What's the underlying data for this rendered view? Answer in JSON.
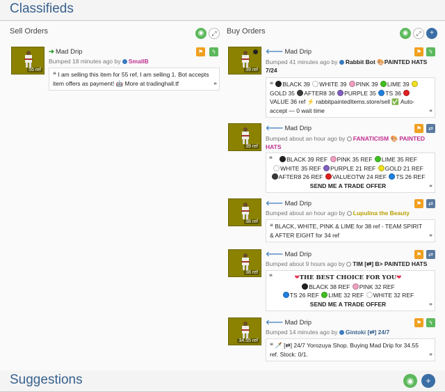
{
  "page": {
    "title": "Classifieds",
    "suggestions_title": "Suggestions"
  },
  "sell": {
    "title": "Sell Orders",
    "listings": [
      {
        "item": "Mad Drip",
        "price": "55 ref",
        "bumped": "Bumped 18 minutes ago by",
        "user": "SmallB",
        "desc": "I am selling this item for 55 ref, I am selling 1. Bot accepts item offers as payment! 🤖 More at tradinghall.tf"
      }
    ]
  },
  "buy": {
    "title": "Buy Orders",
    "listings": [
      {
        "item": "Mad Drip",
        "price": "39 ref",
        "bumped": "Bumped 41 minutes ago by",
        "user": "Rabbit Bot",
        "user_suffix": "🎨PAINTED HATS 7/24",
        "desc_parts": [
          "BLACK 39",
          "WHITE 39",
          "PINK 39",
          "LIME 39",
          "GOLD 35",
          "AFTER8 36",
          "PURPLE 35",
          "TS 36",
          "VALUE 36 ref",
          "⚡ rabbitpaintedItems.store/sell",
          "✅ Auto-accept — 0 wait time"
        ]
      },
      {
        "item": "Mad Drip",
        "price": "39 ref",
        "bumped": "Bumped about an hour ago by",
        "user": "FANATICISM",
        "user_suffix": "🎨 PAINTED HATS",
        "desc_lines": [
          "BLACK 39 REF",
          "PINK 35 REF",
          "LIME 35 REF",
          "WHITE 35 REF",
          "PURPLE 21 REF",
          "GOLD 21 REF",
          "AFTER8 26 REF",
          "VALUEOTW 24 REF",
          "TS 26 REF",
          "SEND ME A TRADE OFFER"
        ]
      },
      {
        "item": "Mad Drip",
        "price": "38 ref",
        "bumped": "Bumped about an hour ago by",
        "user": "Lupulina the Beauty",
        "desc": "BLACK, WHITE, PINK & LIME for 38 ref - TEAM SPIRIT & AFTER EIGHT for 34 ref"
      },
      {
        "item": "Mad Drip",
        "price": "38 ref",
        "bumped": "Bumped about 9 hours ago by",
        "user": "TIM [⇄] B> PAINTED HATS",
        "desc_lines": [
          "THE BEST CHOICE FOR YOU",
          "BLACK 38 REF",
          "PINK 32 REF",
          "TS 26 REF",
          "LIME 32 REF",
          "WHITE 32 REF",
          "SEND ME A TRADE OFFER"
        ]
      },
      {
        "item": "Mad Drip",
        "price": "34.55 ref",
        "bumped": "Bumped 14 minutes ago by",
        "user": "Gintoki [⇄] 24/7",
        "desc": "🗡️ [⇄] 24/7 Yorozuya Shop. Buying Mad Drip for 34.55 ref. Stock: 0/1."
      }
    ]
  },
  "colors": {
    "heading": "#37618d",
    "accent_green": "#5cb85c",
    "orange": "#f0a020",
    "slate": "#5b7aa0",
    "item_bg": "#8a8200"
  },
  "icons": {
    "watch": "eye-icon",
    "expand": "expand-icon",
    "add": "plus-icon",
    "flag": "flag-icon",
    "lightning": "lightning-icon",
    "trade": "trade-icon"
  }
}
